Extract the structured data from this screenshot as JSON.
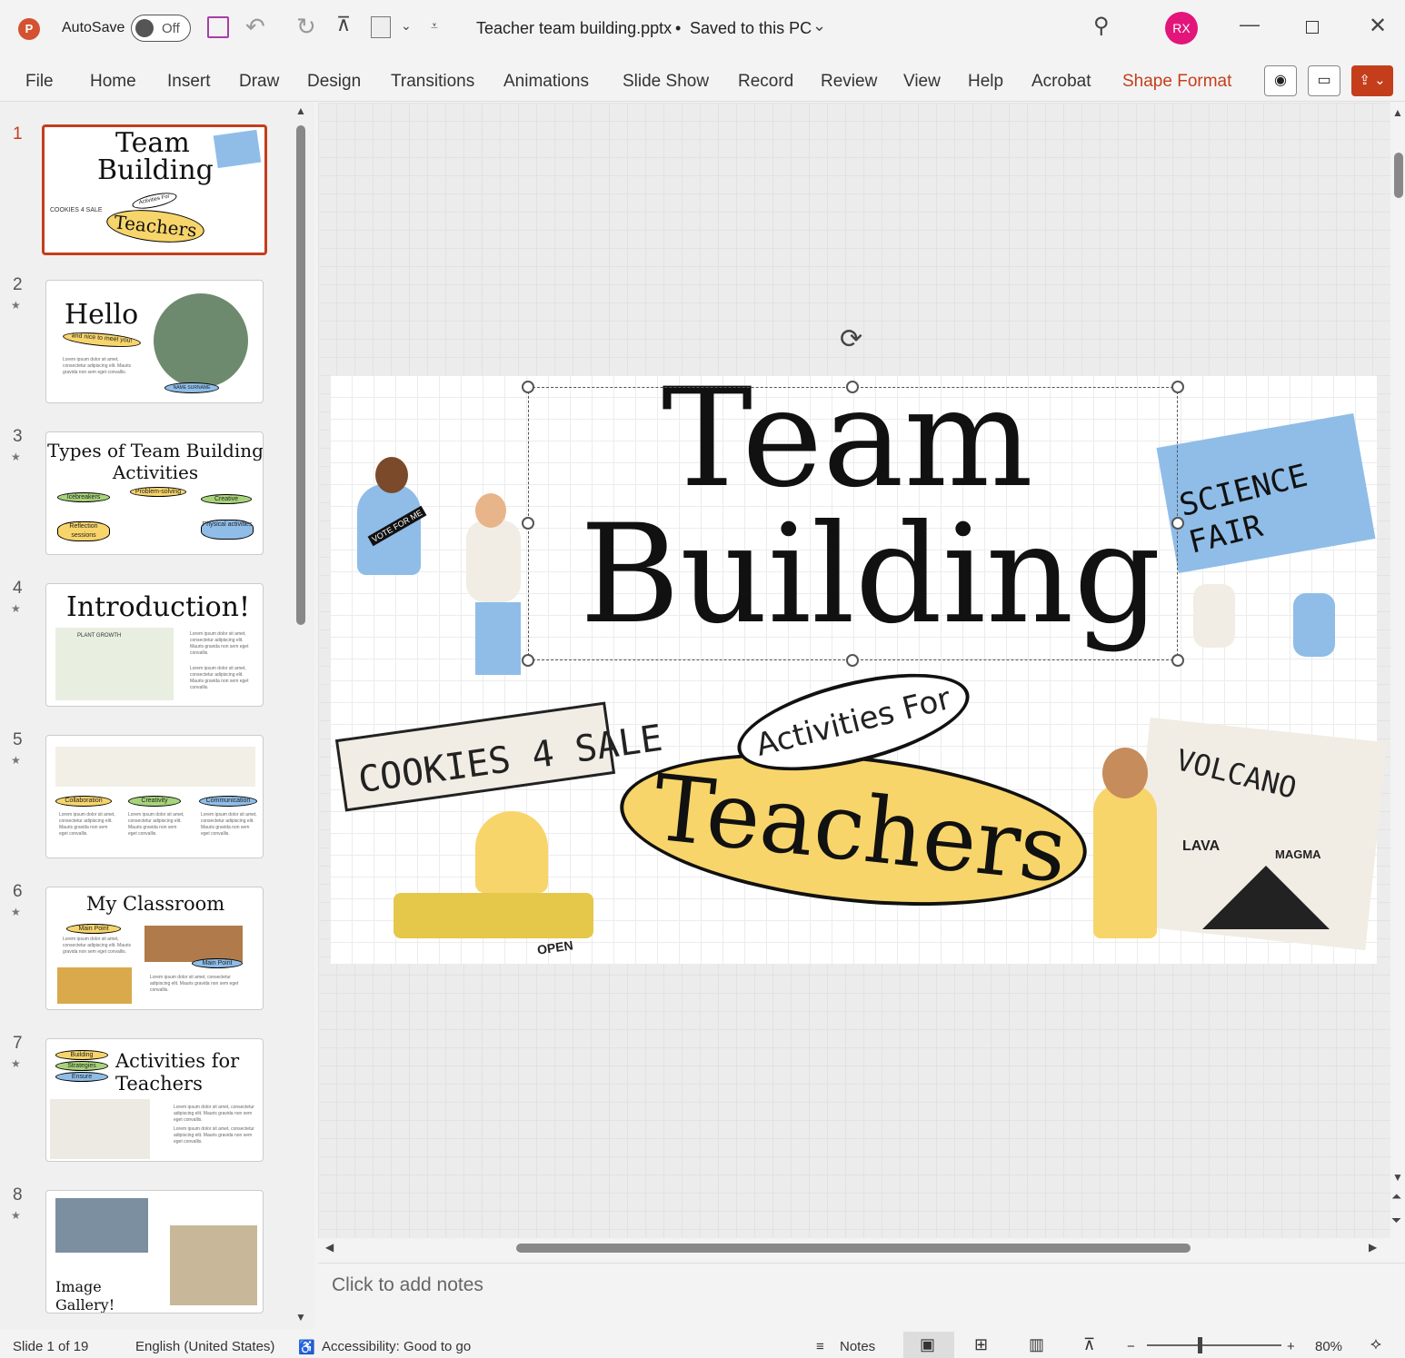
{
  "titlebar": {
    "autosave_label": "AutoSave",
    "autosave_state": "Off",
    "doc_title": "Teacher team building.pptx",
    "save_status": "Saved to this PC",
    "avatar_initials": "RX",
    "accent": "#c43e1c",
    "avatar_color": "#e3157a"
  },
  "ribbon": {
    "tabs": [
      "File",
      "Home",
      "Insert",
      "Draw",
      "Design",
      "Transitions",
      "Animations",
      "Slide Show",
      "Record",
      "Review",
      "View",
      "Help",
      "Acrobat",
      "Shape Format"
    ],
    "active": "Shape Format"
  },
  "thumbnails": [
    {
      "num": "1",
      "title1": "Team",
      "title2": "Building",
      "sub": "Activities For",
      "pill": "Teachers",
      "sign": "COOKIES 4 SALE"
    },
    {
      "num": "2",
      "title": "Hello",
      "pill": "and nice to meet you!",
      "name": "NAME SURNAME"
    },
    {
      "num": "3",
      "title": "Types of Team Building Activities",
      "pills": [
        "Icebreakers",
        "Problem-solving",
        "Creative",
        "Reflection sessions",
        "Physical activities"
      ]
    },
    {
      "num": "4",
      "title": "Introduction!",
      "sign": "PLANT GROWTH"
    },
    {
      "num": "5",
      "pills": [
        "Collaboration",
        "Creativity",
        "Communication"
      ]
    },
    {
      "num": "6",
      "title": "My Classroom",
      "pills": [
        "Main Point",
        "Main Point"
      ]
    },
    {
      "num": "7",
      "title": "Activities for Teachers",
      "pills": [
        "Building",
        "Strategies",
        "Ensure"
      ]
    },
    {
      "num": "8",
      "title": "Image Gallery!"
    }
  ],
  "lorem": "Lorem ipsum dolor sit amet, consectetur adipiscing elit. Mauris gravida non sem eget convallis.",
  "slide": {
    "title1": "Team",
    "title2": "Building",
    "sub": "Activities For",
    "pill": "Teachers",
    "pill_color": "#f7d56b",
    "art": {
      "cookies": "COOKIES 4 SALE",
      "open": "OPEN",
      "science": "SCIENCE FAIR",
      "volcano": "VOLCANO",
      "lava": "LAVA",
      "magma": "MAGMA",
      "vote": "VOTE FOR ME"
    }
  },
  "notes": {
    "placeholder": "Click to add notes"
  },
  "status": {
    "slide": "Slide 1 of 19",
    "language": "English (United States)",
    "accessibility": "Accessibility: Good to go",
    "notes": "Notes",
    "zoom": "80%",
    "zoom_level": 80
  }
}
